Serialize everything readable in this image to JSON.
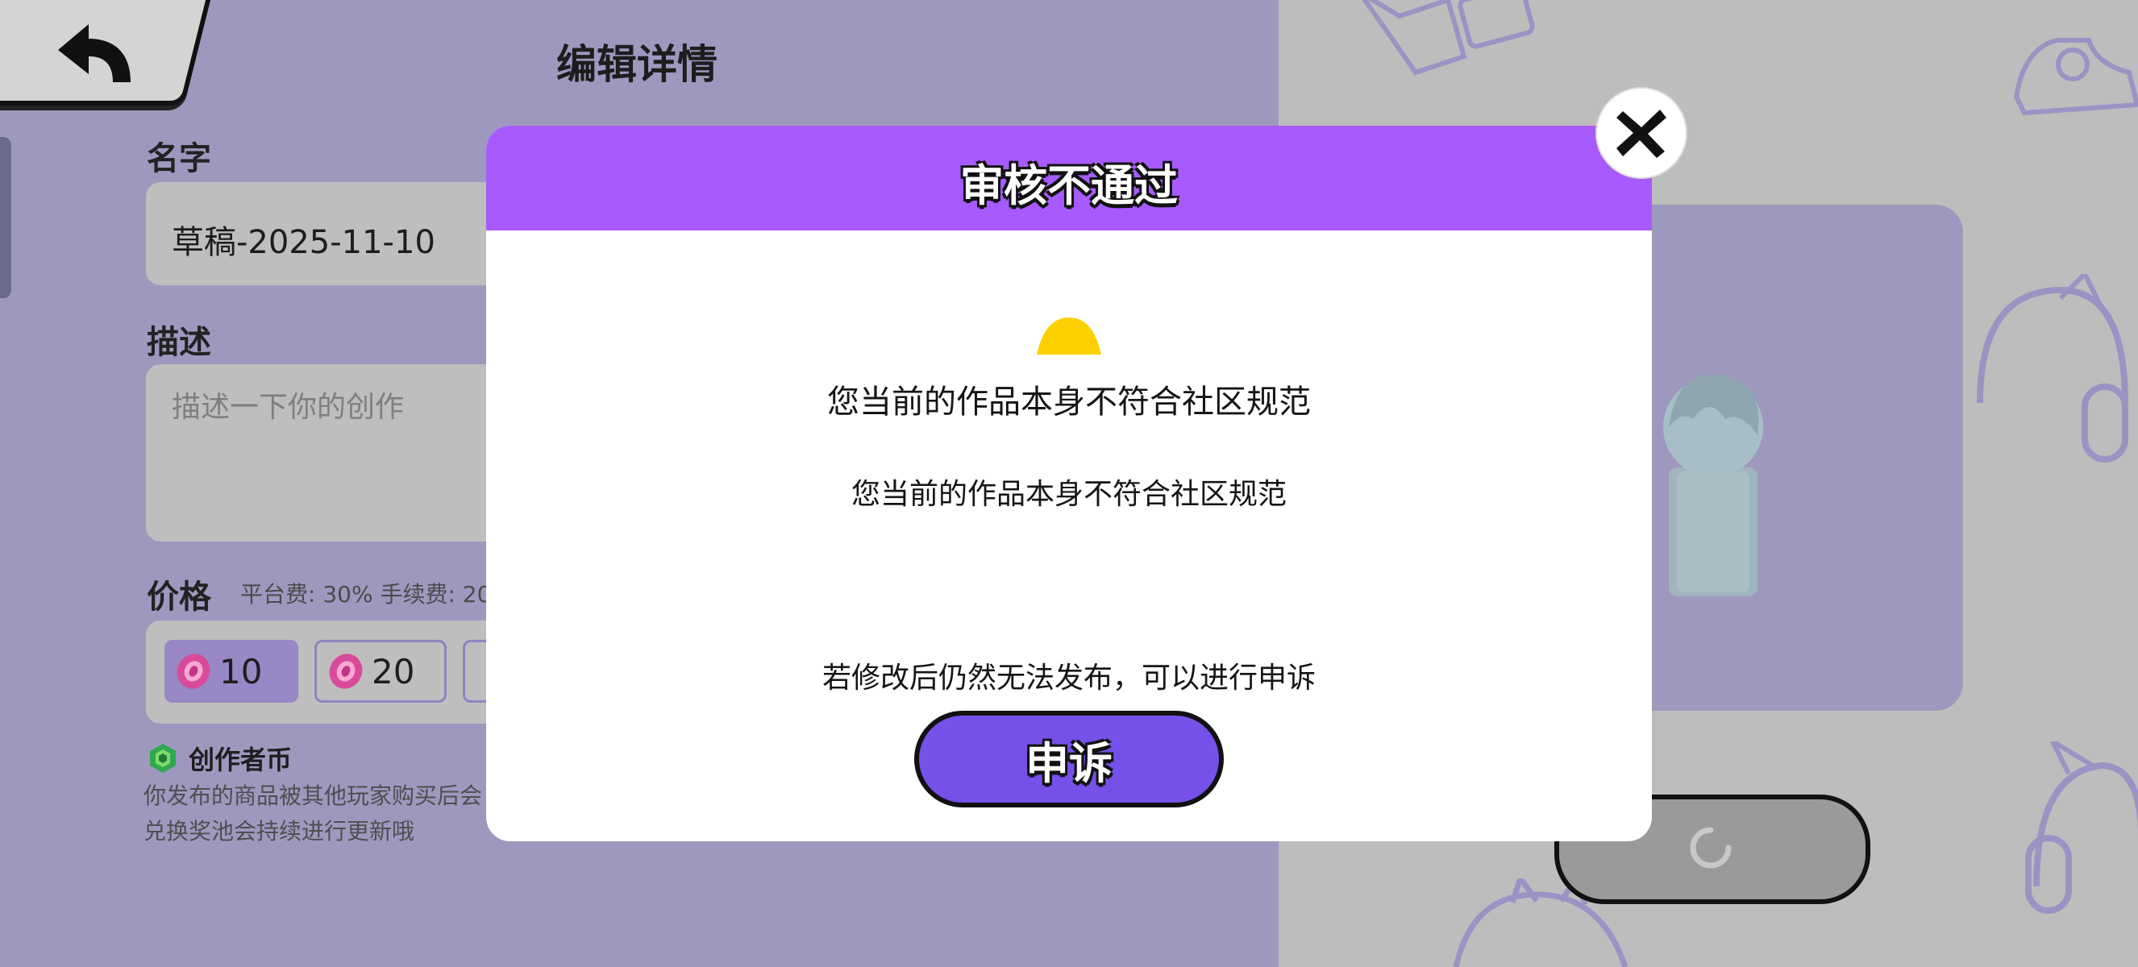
{
  "editor": {
    "page_title": "编辑详情",
    "name_label": "名字",
    "name_value": "草稿-2025-11-10",
    "desc_label": "描述",
    "desc_placeholder": "描述一下你的创作",
    "price_label": "价格",
    "price_hint": "平台费: 30% 手续费: 20",
    "price_options": [
      "10",
      "20"
    ],
    "creator_coin_label": "创作者币",
    "creator_desc_line1": "你发布的商品被其他玩家购买后会",
    "creator_desc_line2": "兑换奖池会持续进行更新哦"
  },
  "dialog": {
    "title": "审核不通过",
    "message_main": "您当前的作品本身不符合社区规范",
    "message_sub": "您当前的作品本身不符合社区规范",
    "hint": "若修改后仍然无法发布，可以进行申诉",
    "appeal_label": "申诉"
  },
  "colors": {
    "dialog_header": "#a75bff",
    "appeal_button": "#7650e8",
    "left_background": "#9f98be",
    "warning": "#ffd000"
  }
}
